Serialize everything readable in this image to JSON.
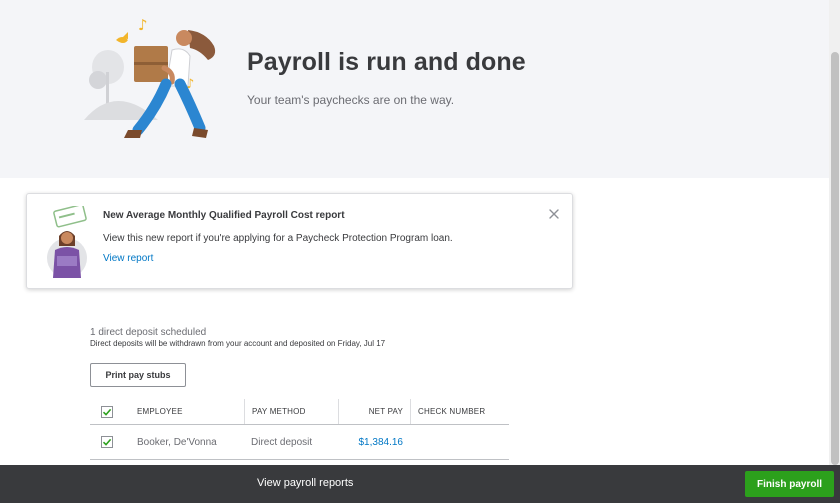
{
  "hero": {
    "title": "Payroll is run and done",
    "subtitle": "Your team's paychecks are on the way."
  },
  "notice": {
    "title": "New Average Monthly Qualified Payroll Cost report",
    "body": "View this new report if you're applying for a Paycheck Protection Program loan.",
    "link_label": "View report",
    "close_icon": "close-icon"
  },
  "deposits": {
    "count_text": "1 direct deposit scheduled",
    "note": "Direct deposits will be withdrawn from your account and deposited on Friday, Jul 17"
  },
  "actions": {
    "print_label": "Print pay stubs"
  },
  "table": {
    "headers": [
      "EMPLOYEE",
      "PAY METHOD",
      "NET PAY",
      "CHECK NUMBER"
    ],
    "rows": [
      {
        "employee": "Booker, De'Vonna",
        "pay_method": "Direct deposit",
        "net_pay": "$1,384.16",
        "check_number": "",
        "selected": true
      }
    ],
    "all_selected": true
  },
  "footer": {
    "reports_label": "View payroll reports",
    "finish_label": "Finish payroll"
  },
  "colors": {
    "accent_green": "#2ca01c",
    "link_blue": "#0077c5",
    "footer_bg": "#393a3d",
    "hero_bg": "#f4f5f8"
  }
}
